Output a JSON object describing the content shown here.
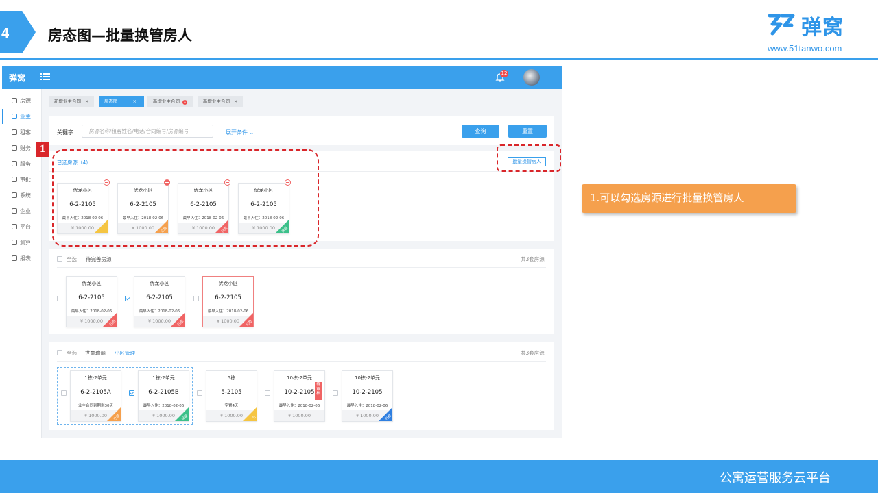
{
  "slide": {
    "step_number": "4",
    "title": "房态图—批量换管房人",
    "logo_text": "弹窝",
    "logo_url": "www.51tanwo.com",
    "footer": "公寓运营服务云平台",
    "marker": "1",
    "callout": "1.可以勾选房源进行批量换管房人"
  },
  "app": {
    "logo": "弹窝",
    "notification_count": "12",
    "sidebar": [
      {
        "label": "房源",
        "icon": "home-icon"
      },
      {
        "label": "业主",
        "icon": "user-icon",
        "active": true
      },
      {
        "label": "租客",
        "icon": "tenant-icon"
      },
      {
        "label": "财务",
        "icon": "finance-icon"
      },
      {
        "label": "服务",
        "icon": "service-icon"
      },
      {
        "label": "审批",
        "icon": "approval-icon"
      },
      {
        "label": "系统",
        "icon": "settings-icon"
      },
      {
        "label": "企业",
        "icon": "company-icon"
      },
      {
        "label": "平台",
        "icon": "platform-icon"
      },
      {
        "label": "测算",
        "icon": "calc-icon"
      },
      {
        "label": "报表",
        "icon": "report-icon"
      }
    ],
    "tabs": [
      {
        "label": "新增业主合同",
        "close": "×"
      },
      {
        "label": "房态图",
        "close": "×",
        "active": true
      },
      {
        "label": "新增业主合同",
        "close": "×"
      },
      {
        "label": "新增业主合同",
        "close": "×"
      }
    ],
    "search": {
      "label": "关键字",
      "placeholder": "房源名称/租客姓名/电话/合同编号/房源编号",
      "expand": "展开条件",
      "query_button": "查询",
      "reset_button": "重置"
    },
    "selected": {
      "title": "已选房源（4）",
      "batch_button": "批量换管房人",
      "cards": [
        {
          "name": "优龙小区",
          "room": "6-2-2105",
          "date": "最早入住：2018-02-06",
          "price": "¥ 1000.00",
          "corner": "#f5c542",
          "corner_text": ""
        },
        {
          "name": "优龙小区",
          "room": "6-2-2105",
          "date": "最早入住：2018-02-06",
          "price": "¥ 1000.00",
          "corner": "#f5a04d",
          "corner_text": "已租"
        },
        {
          "name": "优龙小区",
          "room": "6-2-2105",
          "date": "最早入住：2018-02-06",
          "price": "¥ 1000.00",
          "corner": "#f06464",
          "corner_text": "已签"
        },
        {
          "name": "优龙小区",
          "room": "6-2-2105",
          "date": "最早入住：2018-02-06",
          "price": "¥ 1000.00",
          "corner": "#3cc08a",
          "corner_text": "保留"
        }
      ]
    },
    "group1": {
      "select_all": "全选",
      "title": "待完善房源",
      "count": "共3套房源",
      "cards": [
        {
          "name": "优龙小区",
          "room": "6-2-2105",
          "date": "最早入住：2018-02-06",
          "price": "¥ 1000.00",
          "corner": "#f06464",
          "corner_text": "已签"
        },
        {
          "name": "优龙小区",
          "room": "6-2-2105",
          "date": "最早入住：2018-02-06",
          "price": "¥ 1000.00",
          "corner": "#f06464",
          "corner_text": "已签"
        },
        {
          "name": "优龙小区",
          "room": "6-2-2105",
          "date": "最早入住：2018-02-06",
          "price": "¥ 1000.00",
          "corner": "#f06464",
          "corner_text": "已签"
        }
      ]
    },
    "group2": {
      "select_all": "全选",
      "title": "世豪瑞丽",
      "link": "小区管理",
      "count": "共3套房源",
      "cards": [
        {
          "name": "1栋-2单元",
          "room": "6-2-2105A",
          "date": "业主合同到期剩30天",
          "price": "¥ 1000.00",
          "corner": "#f5a04d",
          "corner_text": "已租"
        },
        {
          "name": "1栋-2单元",
          "room": "6-2-2105B",
          "date": "最早入住：2018-02-06",
          "price": "¥ 1000.00",
          "corner": "#3cc08a",
          "corner_text": "保留"
        },
        {
          "name": "5栋",
          "room": "5-2105",
          "date": "空置4天",
          "price": "¥ 1000.00",
          "corner": "#f5c542",
          "corner_text": "空"
        },
        {
          "name": "10栋-2单元",
          "room": "10-2-2105",
          "date": "最早入住：2018-02-06",
          "price": "¥ 1000.00",
          "corner": "",
          "corner_text": "",
          "side_tag": "待审核"
        },
        {
          "name": "10栋-2单元",
          "room": "10-2-2105",
          "date": "最早入住：2018-02-06",
          "price": "¥ 1000.00",
          "corner": "#2f7fe0",
          "corner_text": "已租"
        }
      ]
    }
  }
}
